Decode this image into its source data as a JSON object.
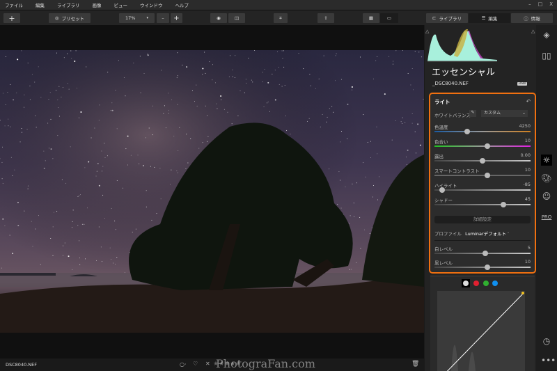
{
  "menu": [
    "ファイル",
    "編集",
    "ライブラリ",
    "画像",
    "ビュー",
    "ウインドウ",
    "ヘルプ"
  ],
  "window_controls": [
    "–",
    "□",
    "X"
  ],
  "toolbar": {
    "add": "+",
    "presets": "プリセット",
    "zoom": "17%",
    "zoom_out": "–",
    "zoom_in": "+",
    "library": "ライブラリ",
    "edit": "編集",
    "info": "情報"
  },
  "panel": {
    "title": "エッセンシャル",
    "filename": "_DSC8040.NEF",
    "raw_badge": "RAW",
    "light": {
      "title": "ライト",
      "wb_label": "ホワイトバランス",
      "wb_value": "カスタム",
      "sliders": [
        {
          "label": "色温度",
          "value": "4250",
          "pos": 0.34
        },
        {
          "label": "色合い",
          "value": "10",
          "pos": 0.55
        },
        {
          "label": "露出",
          "value": "0.00",
          "pos": 0.5
        },
        {
          "label": "スマートコントラスト",
          "value": "10",
          "pos": 0.55
        },
        {
          "label": "ハイライト",
          "value": "-85",
          "pos": 0.08
        },
        {
          "label": "シャドー",
          "value": "45",
          "pos": 0.72
        }
      ],
      "advanced": "詳細設定",
      "profile_label": "プロファイル",
      "profile_value": "Luminarデフォルト",
      "levels": [
        {
          "label": "白レベル",
          "value": "5",
          "pos": 0.53
        },
        {
          "label": "黒レベル",
          "value": "10",
          "pos": 0.55
        }
      ]
    }
  },
  "bottom": {
    "filename": "DSC8040.NEF",
    "watermark": "PhotograFan.com",
    "stars": "★★★★★"
  },
  "colors": {
    "accent": "#f07010"
  }
}
